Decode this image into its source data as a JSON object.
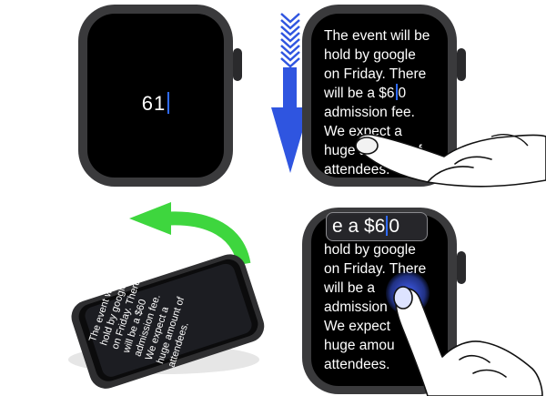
{
  "watch_digits": {
    "value": "61"
  },
  "watch_message": {
    "line1": "The event will be",
    "line2": "hold by google",
    "line3": "on Friday. There",
    "line4a": "will be a $6",
    "line4b": "0",
    "line5": "admission fee.",
    "line6": "We expect a",
    "line7": "huge amount of",
    "line8": "attendees."
  },
  "watch_edit": {
    "magnifier_a": "e a $6",
    "magnifier_b": "0",
    "line2": "hold by google",
    "line3": "on Friday. There",
    "line4": "will be a",
    "line5": "admission",
    "line6": "We expect",
    "line7": "huge amou",
    "line8": "attendees."
  },
  "watch_tilted": {
    "text": "The event will be hold by google on Friday. There will be a admission fee. We expect a huge amount of attendees."
  },
  "colors": {
    "arrow_down": "#2f55e0",
    "arrow_back": "#3ed63e",
    "caret": "#2f6bff"
  }
}
